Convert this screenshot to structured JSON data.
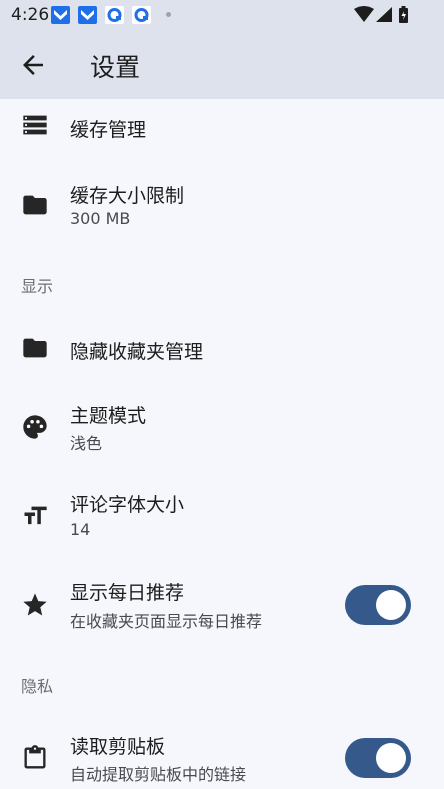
{
  "status_bar": {
    "time": "4:26",
    "notifications": [
      "swift-notification-icon",
      "swift-notification-icon",
      "qq-browser-notification-icon",
      "qq-browser-notification-icon"
    ],
    "right_icons": [
      "wifi-icon",
      "signal-icon",
      "battery-icon"
    ]
  },
  "app_bar": {
    "back_icon": "arrow-back-icon",
    "title": "设置"
  },
  "settings": {
    "cache_manage": {
      "title": "缓存管理",
      "icon": "storage-list-icon"
    },
    "cache_limit": {
      "title": "缓存大小限制",
      "value": "300 MB",
      "icon": "folder-icon"
    },
    "section_display": "显示",
    "hidden_favorites": {
      "title": "隐藏收藏夹管理",
      "icon": "folder-icon"
    },
    "theme_mode": {
      "title": "主题模式",
      "value": "浅色",
      "icon": "palette-icon"
    },
    "comment_font": {
      "title": "评论字体大小",
      "value": "14",
      "icon": "text-size-icon"
    },
    "daily_recommend": {
      "title": "显示每日推荐",
      "subtitle": "在收藏夹页面显示每日推荐",
      "icon": "star-icon",
      "enabled": true
    },
    "section_privacy": "隐私",
    "read_clipboard": {
      "title": "读取剪贴板",
      "subtitle": "自动提取剪贴板中的链接",
      "icon": "clipboard-icon",
      "enabled": true
    }
  },
  "colors": {
    "app_bar_bg": "#dde2ec",
    "page_bg": "#f6f7fc",
    "toggle_on": "#36598c",
    "notification_blue": "#1e6fe8"
  }
}
